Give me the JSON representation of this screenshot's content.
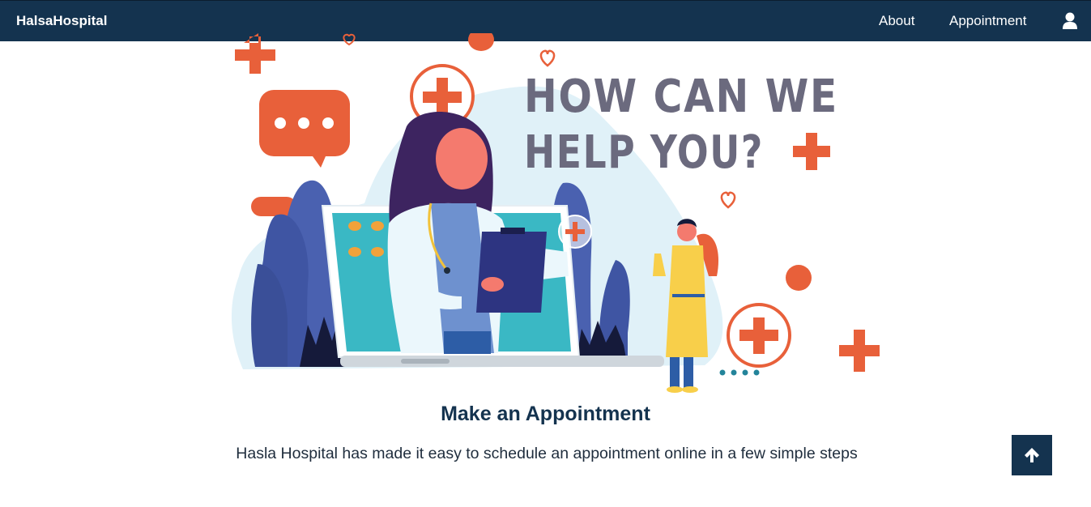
{
  "header": {
    "brand": "HalsaHospital",
    "nav": {
      "about": "About",
      "appointment": "Appointment"
    },
    "user_icon": "user-icon"
  },
  "hero": {
    "headline_line1": "HOW CAN WE",
    "headline_line2": "HELP YOU?"
  },
  "main": {
    "heading": "Make an Appointment",
    "description": "Hasla Hospital has made it easy to schedule an appointment online in a few simple steps"
  },
  "scroll_top": {
    "icon": "arrow-up-icon"
  },
  "colors": {
    "navbar": "#14334f",
    "accent_orange": "#e8603a",
    "headline_gray": "#6b6a7e",
    "blob": "#e0f1f8",
    "plant_blue": "#4a61b0",
    "screen_teal": "#3ab8c4",
    "patient_yellow": "#f8cf4a"
  }
}
